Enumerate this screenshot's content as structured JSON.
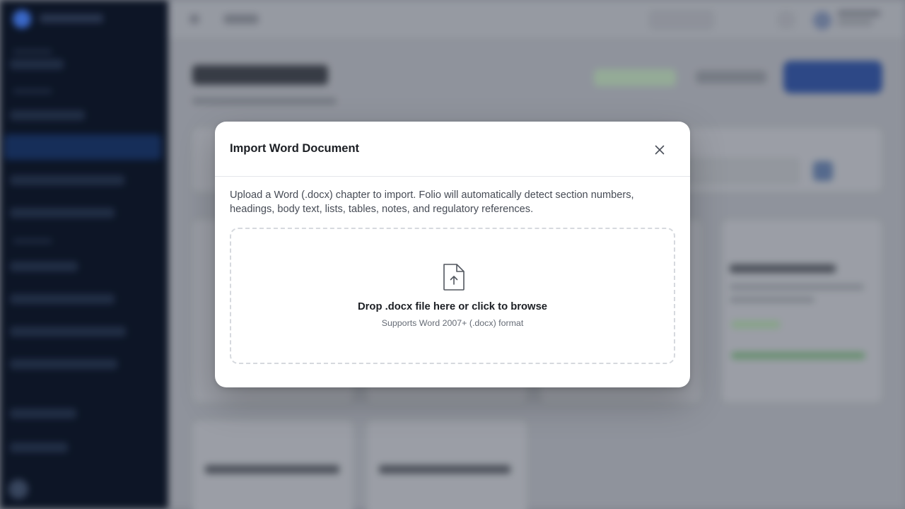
{
  "modal": {
    "title": "Import Word Document",
    "description": "Upload a Word (.docx) chapter to import. Folio will automatically detect section numbers, headings, body text, lists, tables, notes, and regulatory references.",
    "close_icon": "close-icon",
    "dropzone": {
      "icon": "file-upload-icon",
      "title": "Drop .docx file here or click to browse",
      "subtitle": "Supports Word 2007+ (.docx) format"
    }
  },
  "background": {
    "page_title": "Manual Library",
    "accent_color": "#3d6fd6",
    "sidebar_color": "#0c1526"
  }
}
